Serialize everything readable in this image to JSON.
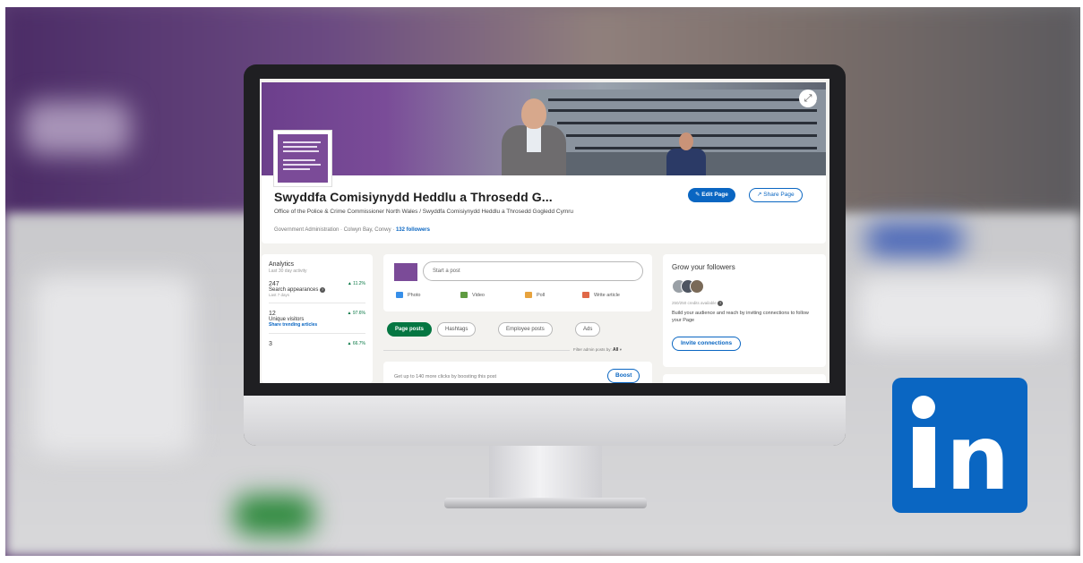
{
  "page": {
    "org_name": "Swyddfa Comisiynydd Heddlu a Throsedd G...",
    "tagline": "Office of the Police & Crime Commissioner North Wales / Swyddfa Comisiynydd Heddlu a Throsedd Gogledd Cymru",
    "meta_prefix": "Government Administration · Colwyn Bay, Conwy · ",
    "followers": "132 followers",
    "edit_label": "Edit Page",
    "share_label": "Share Page"
  },
  "analytics": {
    "title": "Analytics",
    "subtitle": "Last 30 day activity",
    "rows": [
      {
        "value": "247",
        "label": "Search appearances",
        "sub": "Last 7 days",
        "change": "▲ 11.2%"
      },
      {
        "value": "12",
        "label": "Unique visitors",
        "link": "Share trending articles",
        "change": "▲ 97.6%"
      },
      {
        "value": "3",
        "change": "▲ 66.7%"
      }
    ]
  },
  "composer": {
    "placeholder": "Start a post",
    "actions": [
      "Photo",
      "Video",
      "Poll",
      "Write article"
    ]
  },
  "filters": {
    "pills": [
      "Page posts",
      "Hashtags",
      "Employee posts",
      "Ads"
    ],
    "admin_label": "Filter admin posts by:",
    "admin_value": "All"
  },
  "boost": {
    "text": "Get up to 140 more clicks by boosting this post",
    "button": "Boost"
  },
  "grow": {
    "title": "Grow your followers",
    "credits": "250/250 credits available",
    "description": "Build your audience and reach by inviting connections to follow your Page",
    "button": "Invite connections"
  },
  "colors": {
    "linkedin_blue": "#0a66c2",
    "brand_purple": "#7b4b98",
    "active_green": "#057642"
  },
  "icons": {
    "logo": "linkedin-logo-icon",
    "edit": "pencil-icon",
    "share": "share-arrow-icon",
    "expand": "expand-icon"
  }
}
